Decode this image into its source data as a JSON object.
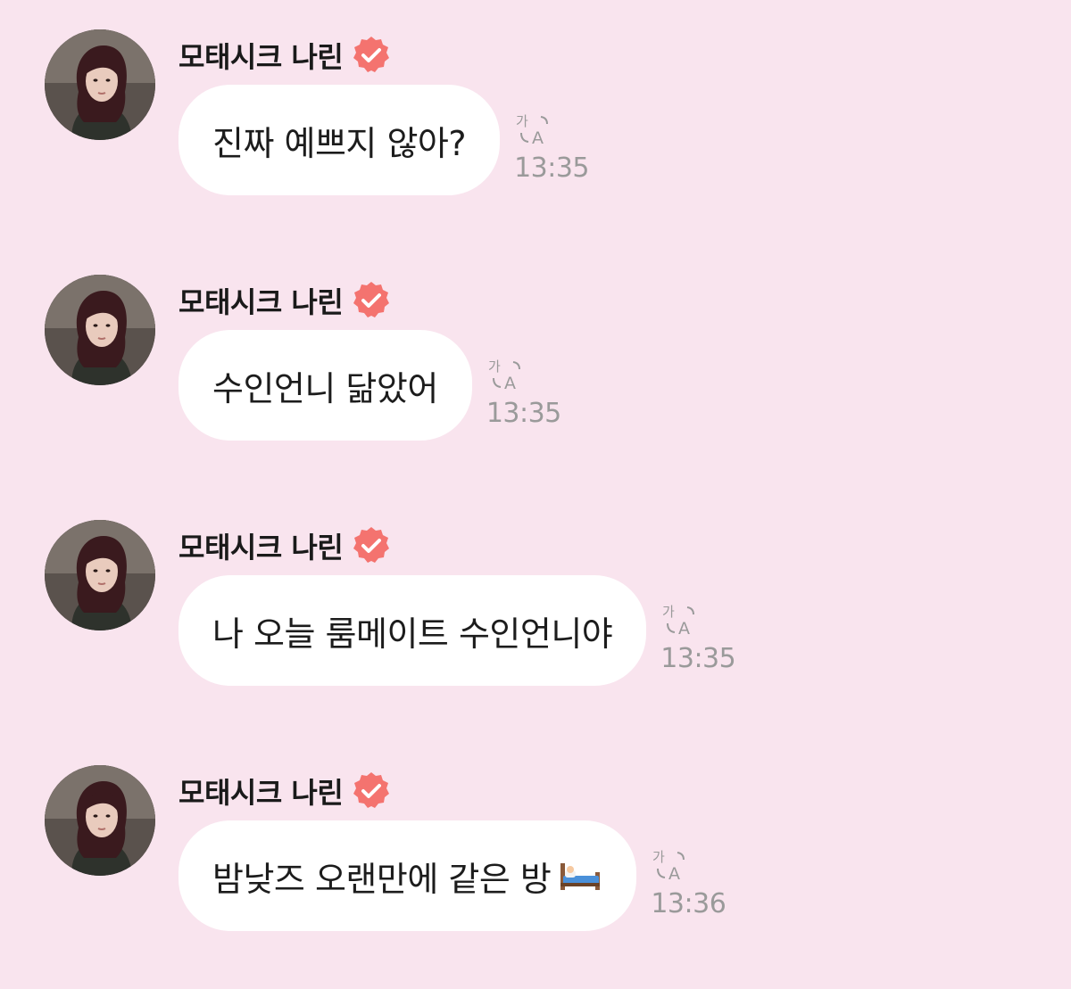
{
  "colors": {
    "background": "#f9e4ee",
    "bubble": "#ffffff",
    "badge": "#f4736f",
    "timestamp": "#9a9a9a"
  },
  "messages": [
    {
      "sender": "모태시크 나린",
      "verified_icon": "verified-badge-icon",
      "text": "진짜 예쁘지 않아?",
      "time": "13:35",
      "translate_icon": "translate-icon"
    },
    {
      "sender": "모태시크 나린",
      "verified_icon": "verified-badge-icon",
      "text": "수인언니 닮았어",
      "time": "13:35",
      "translate_icon": "translate-icon"
    },
    {
      "sender": "모태시크 나린",
      "verified_icon": "verified-badge-icon",
      "text": "나 오늘 룸메이트 수인언니야",
      "time": "13:35",
      "translate_icon": "translate-icon"
    },
    {
      "sender": "모태시크 나린",
      "verified_icon": "verified-badge-icon",
      "text": "밤낮즈 오랜만에 같은 방",
      "emoji": "bed-emoji-icon",
      "time": "13:36",
      "translate_icon": "translate-icon"
    }
  ]
}
